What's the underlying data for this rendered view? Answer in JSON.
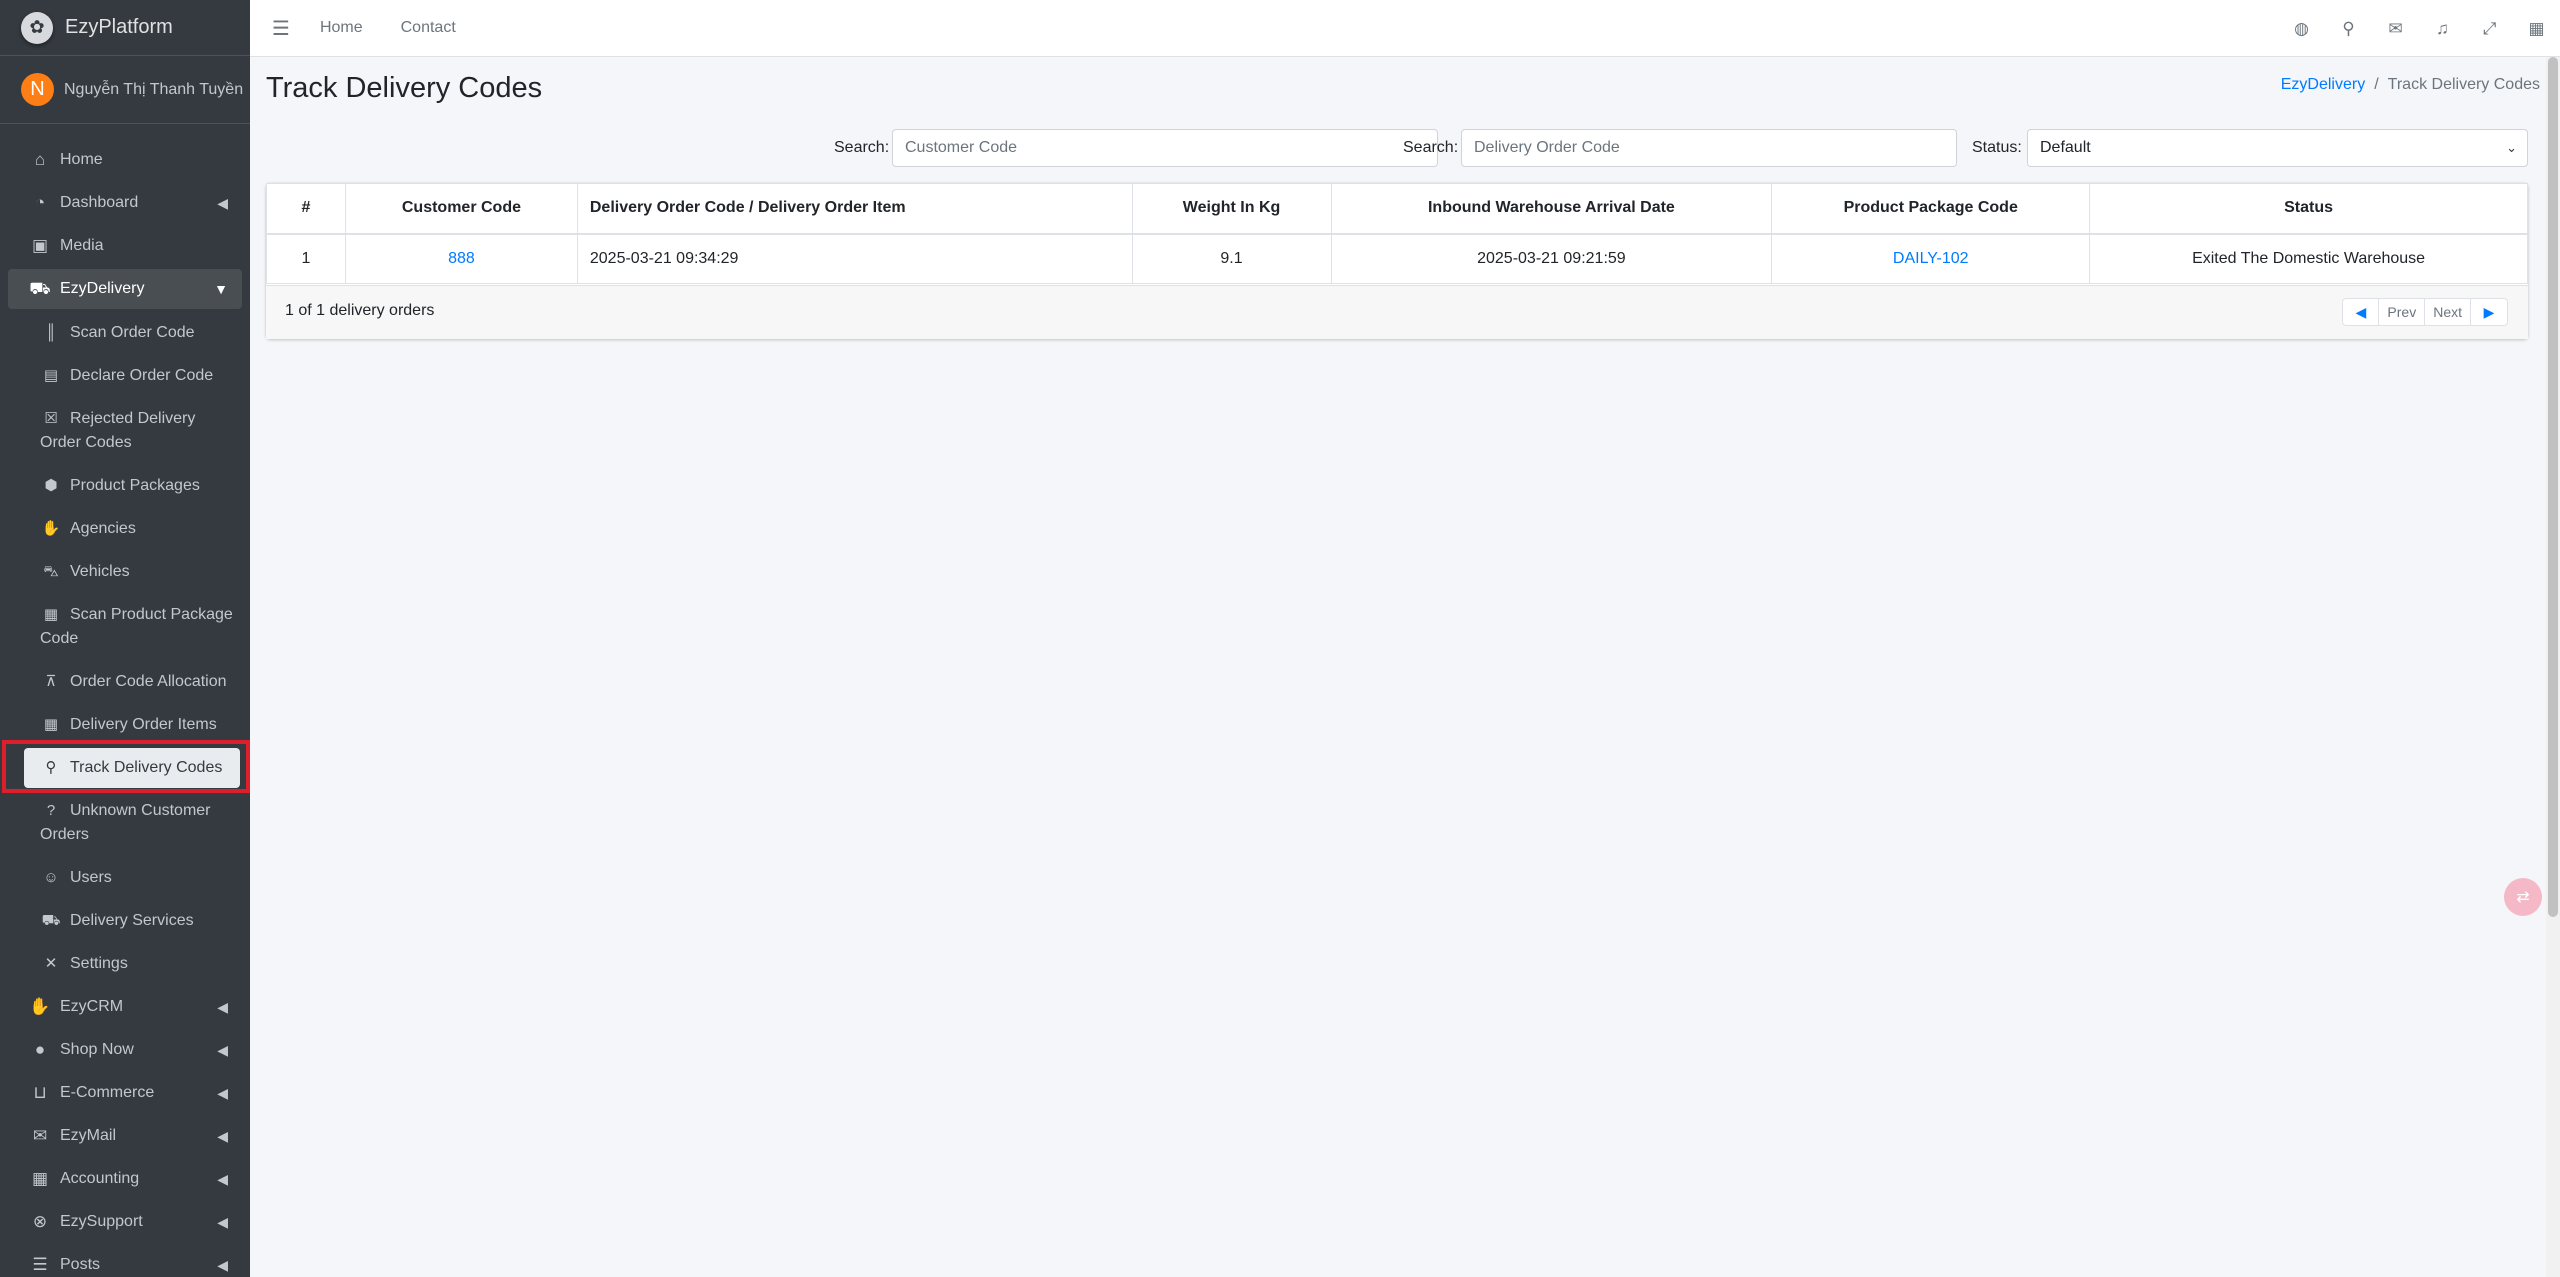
{
  "brand": {
    "name": "EzyPlatform",
    "logo_icon": "logo-icon"
  },
  "user": {
    "initial": "N",
    "name": "Nguyễn Thị Thanh Tuyền"
  },
  "sidebar": {
    "items": [
      {
        "label": "Home",
        "icon": "home-icon"
      },
      {
        "label": "Dashboard",
        "icon": "dashboard-icon"
      },
      {
        "label": "Media",
        "icon": "image-icon"
      },
      {
        "label": "EzyDelivery",
        "icon": "truck-icon"
      }
    ],
    "sub_items": [
      {
        "label": "Scan Order Code",
        "icon": "barcode-icon"
      },
      {
        "label": "Declare Order Code",
        "icon": "file-icon"
      },
      {
        "label": "Rejected Delivery Order Codes",
        "line1": "Rejected Delivery",
        "line2": "Order Codes",
        "icon": "x-box-icon"
      },
      {
        "label": "Product Packages",
        "icon": "boxes-icon"
      },
      {
        "label": "Agencies",
        "icon": "handshake-icon"
      },
      {
        "label": "Vehicles",
        "icon": "vehicle-icon"
      },
      {
        "label": "Scan Product Package Code",
        "line1": "Scan Product Package",
        "line2": "Code",
        "icon": "qrcode-icon"
      },
      {
        "label": "Order Code Allocation",
        "icon": "sitemap-icon"
      },
      {
        "label": "Delivery Order Items",
        "icon": "grid-icon"
      },
      {
        "label": "Track Delivery Codes",
        "icon": "search-icon"
      },
      {
        "label": "Unknown Customer Orders",
        "line1": "Unknown Customer",
        "line2": "Orders",
        "icon": "question-icon"
      },
      {
        "label": "Users",
        "icon": "users-icon"
      },
      {
        "label": "Delivery Services",
        "icon": "truck-icon"
      },
      {
        "label": "Settings",
        "icon": "tools-icon"
      }
    ],
    "more_items": [
      {
        "label": "EzyCRM",
        "icon": "handshake-icon"
      },
      {
        "label": "Shop Now",
        "icon": "circle-icon"
      },
      {
        "label": "E-Commerce",
        "icon": "basket-icon"
      },
      {
        "label": "EzyMail",
        "icon": "envelope-icon"
      },
      {
        "label": "Accounting",
        "icon": "calculator-icon"
      },
      {
        "label": "EzySupport",
        "icon": "lifebuoy-icon"
      },
      {
        "label": "Posts",
        "icon": "list-icon"
      }
    ]
  },
  "topbar": {
    "links": [
      "Home",
      "Contact"
    ],
    "icons": [
      "globe-icon",
      "search-icon",
      "comments-icon",
      "bell-icon",
      "expand-icon",
      "apps-icon"
    ]
  },
  "page": {
    "title": "Track Delivery Codes",
    "breadcrumb": [
      "EzyDelivery",
      "Track Delivery Codes"
    ]
  },
  "filters": {
    "search1_label": "Search:",
    "search1_placeholder": "Customer Code",
    "search2_label": "Search:",
    "search2_placeholder": "Delivery Order Code",
    "status_label": "Status:",
    "status_value": "Default"
  },
  "table": {
    "headers": [
      "#",
      "Customer Code",
      "Delivery Order Code / Delivery Order Item",
      "Weight In Kg",
      "Inbound Warehouse Arrival Date",
      "Product Package Code",
      "Status"
    ],
    "rows": [
      [
        "1",
        "888",
        "2025-03-21 09:34:29",
        "9.1",
        "2025-03-21 09:21:59",
        "DAILY-102",
        "Exited The Domestic Warehouse"
      ]
    ]
  },
  "footer": {
    "count_text": "1 of 1 delivery orders",
    "prev": "Prev",
    "next": "Next"
  }
}
